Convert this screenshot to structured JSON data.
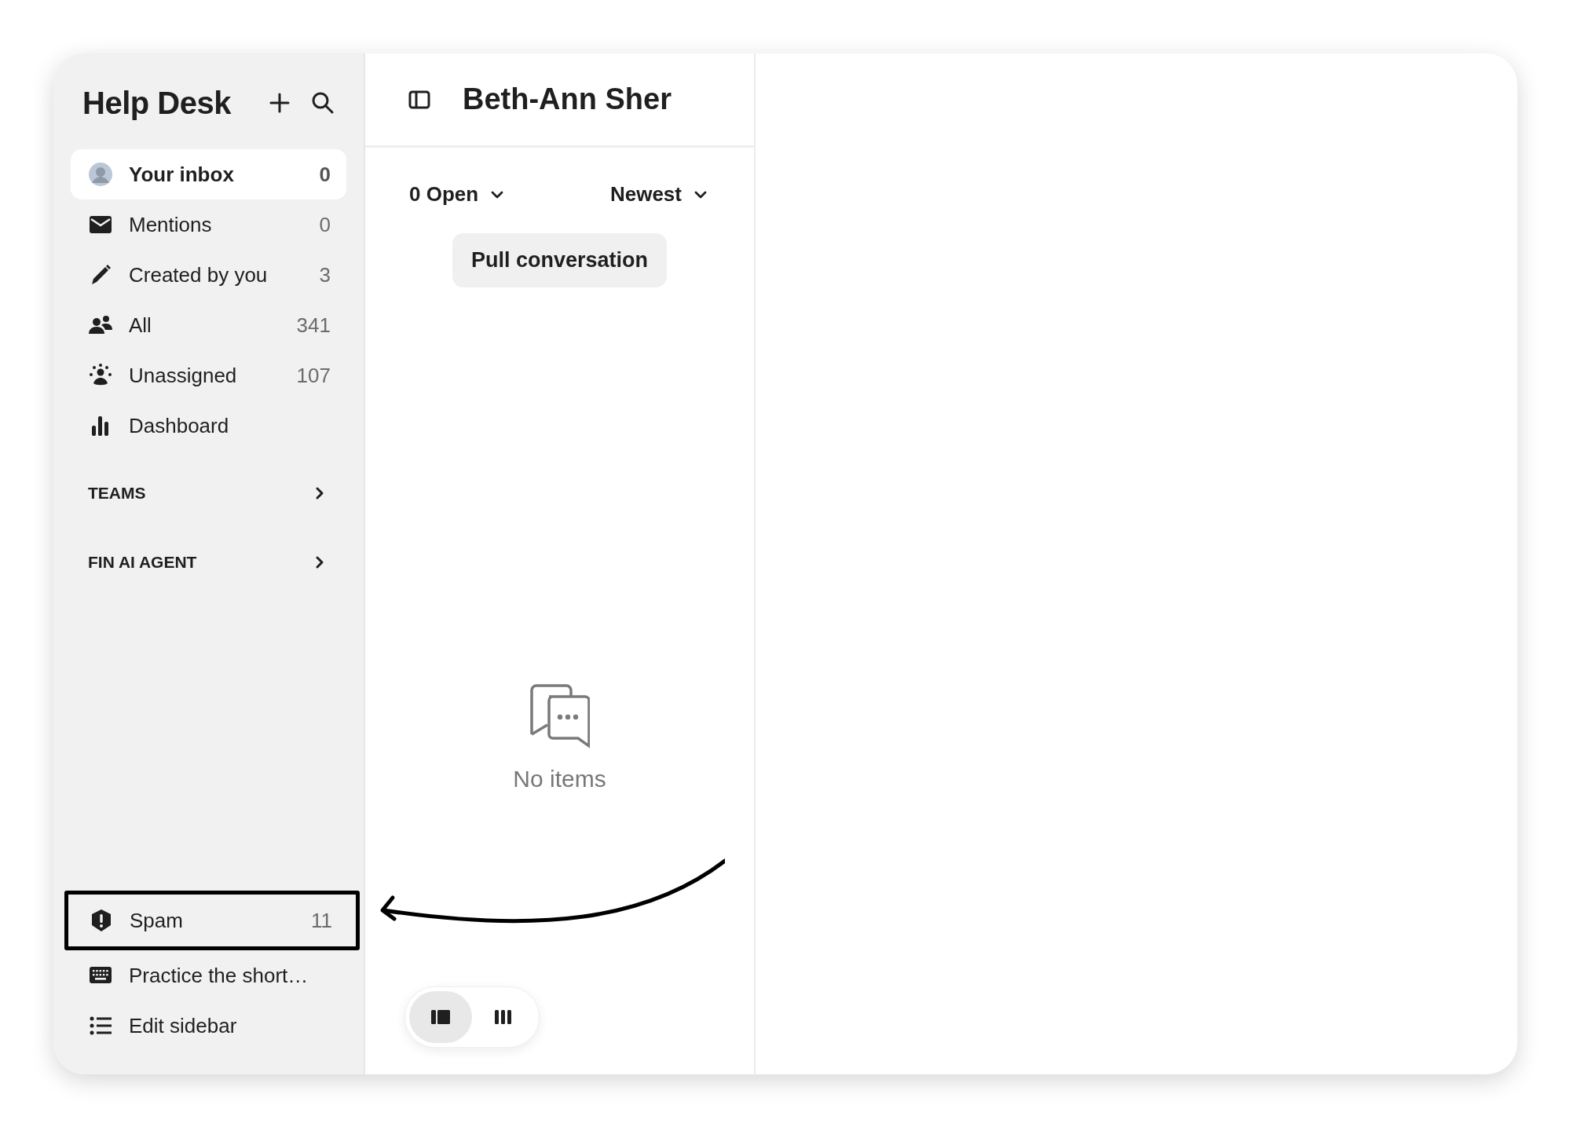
{
  "sidebar": {
    "title": "Help Desk",
    "items": [
      {
        "kind": "avatar",
        "label": "Your inbox",
        "count": "0",
        "selected": true
      },
      {
        "kind": "mail",
        "label": "Mentions",
        "count": "0",
        "selected": false
      },
      {
        "kind": "pencil",
        "label": "Created by you",
        "count": "3",
        "selected": false
      },
      {
        "kind": "people",
        "label": "All",
        "count": "341",
        "selected": false
      },
      {
        "kind": "unassigned",
        "label": "Unassigned",
        "count": "107",
        "selected": false
      },
      {
        "kind": "chart",
        "label": "Dashboard",
        "selected": false
      }
    ],
    "sections": [
      {
        "label": "TEAMS",
        "expanded": false
      },
      {
        "label": "FIN AI AGENT",
        "expanded": false
      }
    ],
    "bottom_items": [
      {
        "kind": "spam",
        "label": "Spam",
        "count": "11",
        "outlined": true
      },
      {
        "kind": "keyboard",
        "label": "Practice the short…",
        "outlined": false
      },
      {
        "kind": "list",
        "label": "Edit sidebar",
        "outlined": false
      }
    ]
  },
  "inbox": {
    "title": "Beth-Ann Sher",
    "status_filter": "0 Open",
    "sort": "Newest",
    "button": "Pull conversation",
    "empty_text": "No items",
    "layout_options": [
      {
        "kind": "split",
        "selected": true
      },
      {
        "kind": "columns",
        "selected": false
      }
    ]
  }
}
